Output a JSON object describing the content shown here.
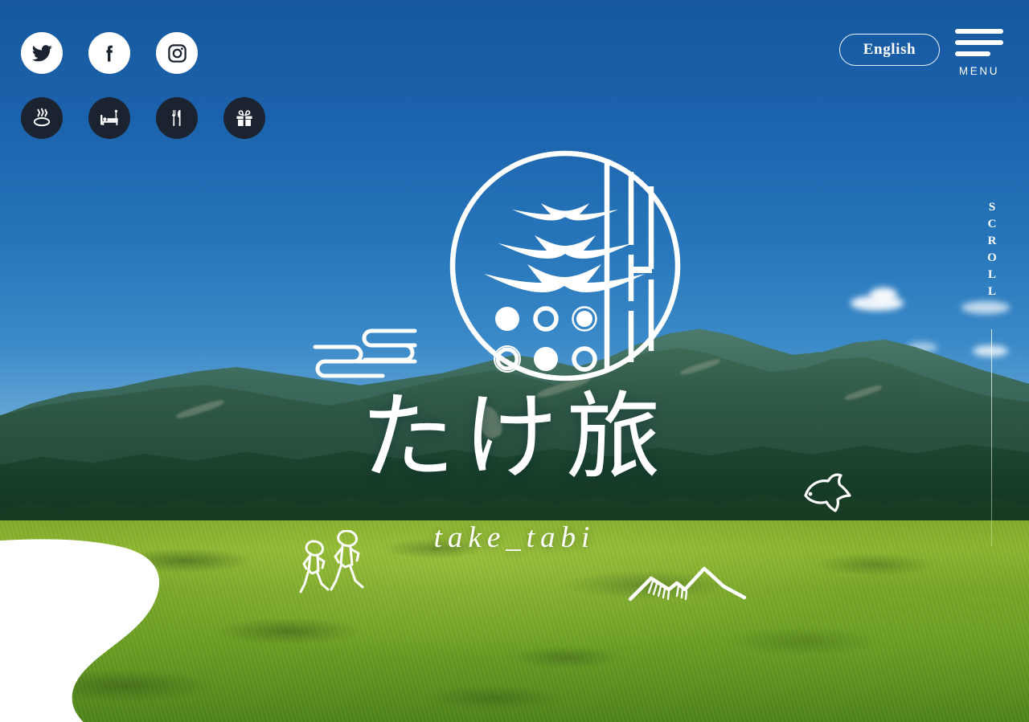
{
  "site": {
    "title_jp": "たけ旅",
    "title_en": "take_tabi"
  },
  "header": {
    "language_button": "English",
    "menu_label": "MENU",
    "menu_icon": "hamburger-icon"
  },
  "scroll_indicator": {
    "label": "SCROLL"
  },
  "social_links": [
    {
      "name": "twitter",
      "icon": "twitter-icon",
      "style": "light"
    },
    {
      "name": "facebook",
      "icon": "facebook-icon",
      "style": "light"
    },
    {
      "name": "instagram",
      "icon": "instagram-icon",
      "style": "light"
    }
  ],
  "category_links": [
    {
      "name": "onsen",
      "icon": "hot-spring-icon",
      "style": "dark"
    },
    {
      "name": "stay",
      "icon": "bed-icon",
      "style": "dark"
    },
    {
      "name": "eat",
      "icon": "restaurant-icon",
      "style": "dark"
    },
    {
      "name": "souvenir",
      "icon": "gift-icon",
      "style": "dark"
    }
  ],
  "logo": {
    "name": "take-tabi-circular-emblem",
    "elements": [
      "pagoda-roof",
      "six-dots",
      "bamboo-stalks",
      "circle-border"
    ]
  },
  "doodles": [
    {
      "name": "cloud-motif",
      "icon": "cloud-doodle-icon"
    },
    {
      "name": "walking-people",
      "icon": "people-walking-doodle-icon"
    },
    {
      "name": "fish",
      "icon": "fish-doodle-icon"
    },
    {
      "name": "mountains",
      "icon": "mountain-doodle-icon"
    }
  ],
  "colors": {
    "sky_top": "#14589f",
    "sky_bottom": "#64a6d6",
    "icon_dark": "#1c2330",
    "icon_light": "#ffffff",
    "accent_white": "#ffffff",
    "meadow_green": "#8fb832"
  },
  "background": {
    "scene": "mountain-landscape-photo",
    "description": "blue sky over green mountains with meadow"
  }
}
